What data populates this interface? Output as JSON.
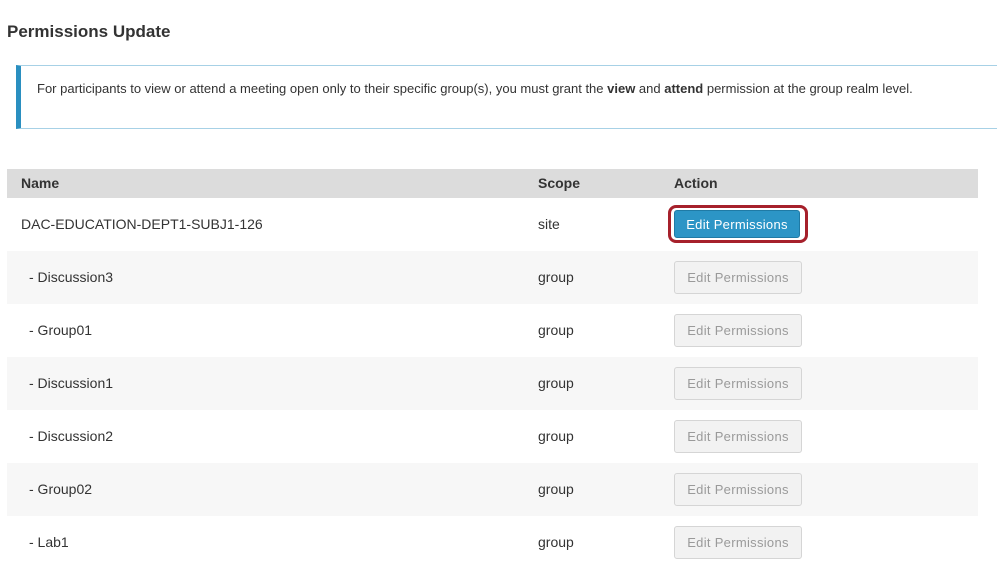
{
  "page": {
    "title": "Permissions Update"
  },
  "info": {
    "text_before": "For participants to view or attend a meeting open only to their specific group(s), you must grant the ",
    "bold_view": "view",
    "text_and": " and ",
    "bold_attend": "attend",
    "text_after": " permission at the group realm level."
  },
  "table": {
    "headers": {
      "name": "Name",
      "scope": "Scope",
      "action": "Action"
    },
    "rows": [
      {
        "name": "DAC-EDUCATION-DEPT1-SUBJ1-126",
        "scope": "site",
        "action": "Edit Permissions",
        "enabled": true
      },
      {
        "name": "- Discussion3",
        "scope": "group",
        "action": "Edit Permissions",
        "enabled": false
      },
      {
        "name": "- Group01",
        "scope": "group",
        "action": "Edit Permissions",
        "enabled": false
      },
      {
        "name": "- Discussion1",
        "scope": "group",
        "action": "Edit Permissions",
        "enabled": false
      },
      {
        "name": "- Discussion2",
        "scope": "group",
        "action": "Edit Permissions",
        "enabled": false
      },
      {
        "name": "- Group02",
        "scope": "group",
        "action": "Edit Permissions",
        "enabled": false
      },
      {
        "name": "- Lab1",
        "scope": "group",
        "action": "Edit Permissions",
        "enabled": false
      }
    ]
  },
  "colors": {
    "primary_button": "#2c95c6",
    "highlight_ring": "#a6202b",
    "info_border": "#2a8fc0",
    "header_bg": "#dcdcdc"
  }
}
